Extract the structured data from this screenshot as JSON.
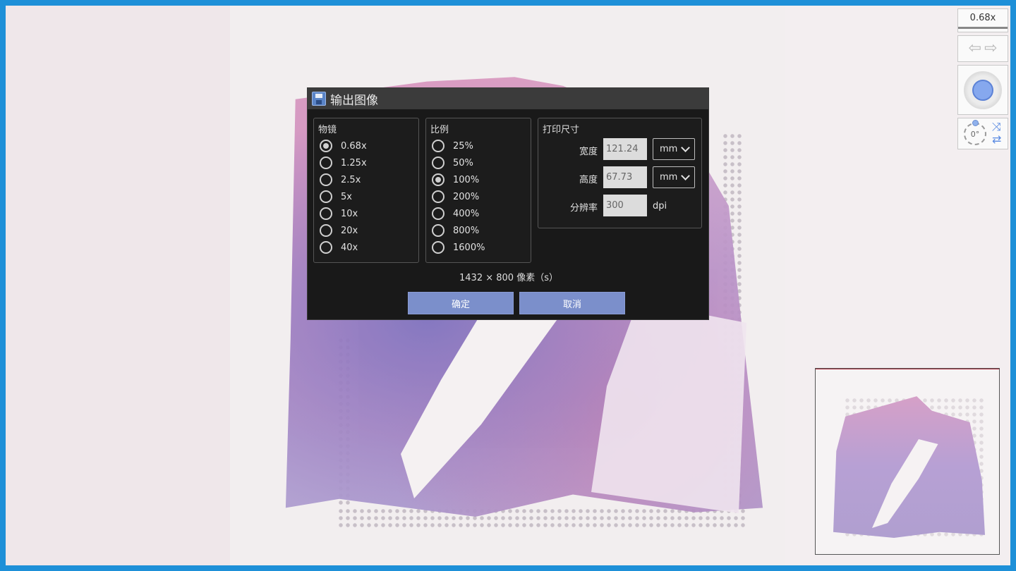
{
  "dialog": {
    "title": "输出图像",
    "objective_group": {
      "label": "物镜",
      "options": [
        "0.68x",
        "1.25x",
        "2.5x",
        "5x",
        "10x",
        "20x",
        "40x"
      ],
      "selected": "0.68x"
    },
    "scale_group": {
      "label": "比例",
      "options": [
        "25%",
        "50%",
        "100%",
        "200%",
        "400%",
        "800%",
        "1600%"
      ],
      "selected": "100%"
    },
    "print_group": {
      "label": "打印尺寸",
      "width_label": "宽度",
      "width_value": "121.24",
      "width_unit": "mm",
      "height_label": "高度",
      "height_value": "67.73",
      "height_unit": "mm",
      "resolution_label": "分辨率",
      "resolution_value": "300",
      "resolution_unit": "dpi"
    },
    "pixel_info": "1432 × 800 像素（s）",
    "ok_label": "确定",
    "cancel_label": "取消"
  },
  "toolbar": {
    "zoom_value": "0.68x",
    "back_icon": "arrow-left-icon",
    "forward_icon": "arrow-right-icon",
    "rotation_value": "0°"
  },
  "colors": {
    "window_border": "#1e90d8",
    "dialog_bg": "#191919",
    "button_bg": "#7b8fcb",
    "nav_accent": "#86a8ee"
  }
}
